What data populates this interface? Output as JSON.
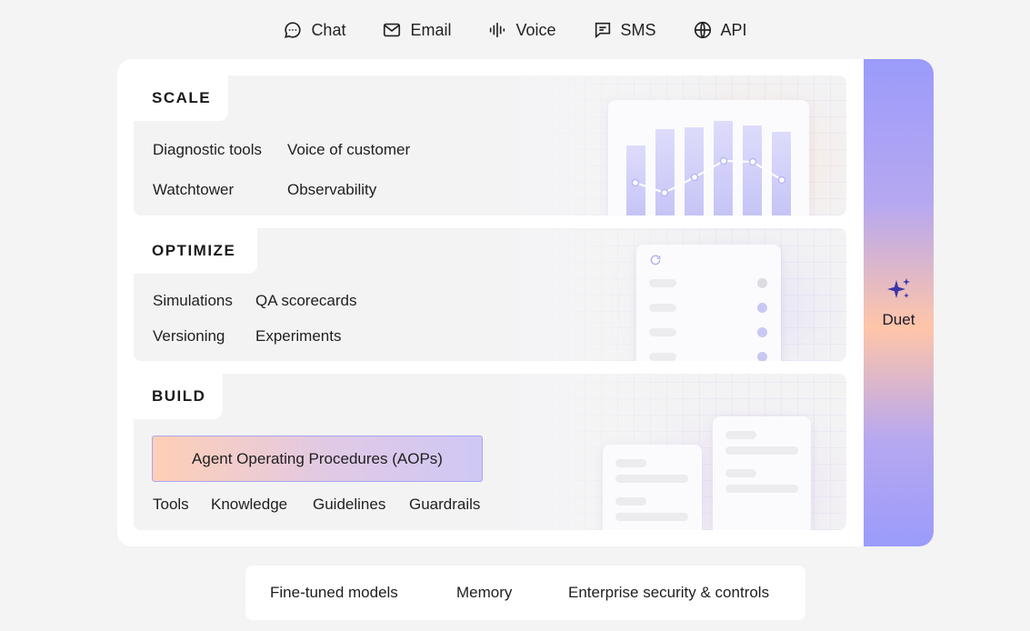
{
  "channels": [
    {
      "label": "Chat",
      "icon": "chat-bubble-icon"
    },
    {
      "label": "Email",
      "icon": "envelope-icon"
    },
    {
      "label": "Voice",
      "icon": "waveform-icon"
    },
    {
      "label": "SMS",
      "icon": "message-icon"
    },
    {
      "label": "API",
      "icon": "globe-icon"
    }
  ],
  "layers": {
    "scale": {
      "title": "SCALE",
      "items": [
        "Diagnostic tools",
        "Voice of customer",
        "Watchtower",
        "Observability"
      ]
    },
    "optimize": {
      "title": "OPTIMIZE",
      "items": [
        "Simulations",
        "QA scorecards",
        "Versioning",
        "Experiments"
      ]
    },
    "build": {
      "title": "BUILD",
      "highlight": "Agent Operating Procedures (AOPs)",
      "items": [
        "Tools",
        "Knowledge",
        "Guidelines",
        "Guardrails"
      ]
    }
  },
  "duet": {
    "label": "Duet",
    "icon": "sparkle-icon"
  },
  "foundation": {
    "items": [
      "Fine-tuned models",
      "Memory",
      "Enterprise security & controls"
    ]
  },
  "colors": {
    "accent": "#9b9bfb",
    "peach": "#ffc5a8",
    "bar": "#c8c7f6"
  }
}
